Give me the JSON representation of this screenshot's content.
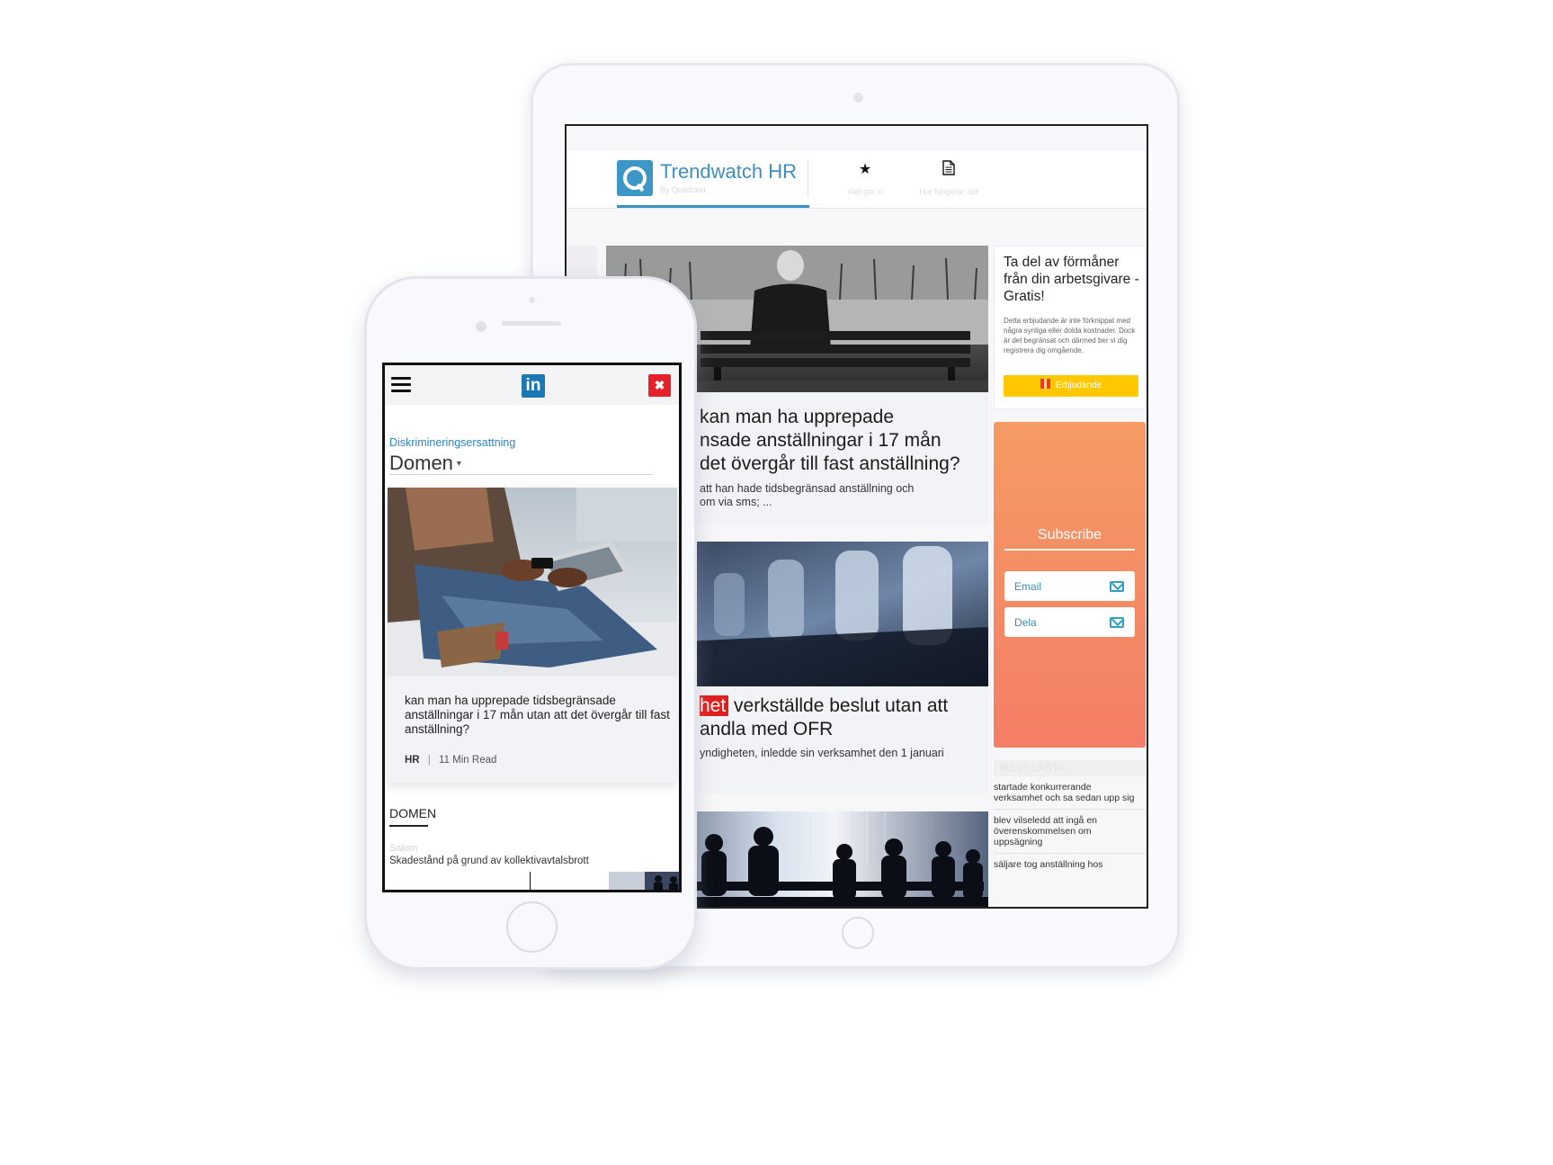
{
  "tablet": {
    "brand": "Trendwatch HR",
    "brand_sub": "By Quaticket",
    "nav": [
      {
        "icon": "star-icon",
        "label": "Vad gör vi"
      },
      {
        "icon": "document-icon",
        "label": "Hur fungerar det"
      }
    ],
    "articles": [
      {
        "title": "kan man ha upprepade tidsbegränsade anställningar i 17 mån utan att det övergår till fast anställning?",
        "title_lines": [
          "kan man ha upprepade",
          "nsade anställningar i 17 mån",
          "det övergår till fast anställning?"
        ],
        "desc_lines": [
          "att han hade tidsbegränsad anställning och",
          "om via sms; ..."
        ]
      },
      {
        "title_red": "het",
        "title_lines": [
          " verkställde beslut utan att",
          "andla med OFR"
        ],
        "desc_lines": [
          "yndigheten, inledde sin verksamhet den 1 januari"
        ]
      }
    ],
    "promo": {
      "title": "Ta del av förmåner från din arbetsgivare - Gratis!",
      "text": "Detta erbjudande är inte förknippat med några synliga eller dolda kostnader. Dock är det begränsat och därmed ber vi dig registrera dig omgående.",
      "button": "Erbjudande"
    },
    "subscribe": {
      "title": "Subscribe",
      "email_placeholder": "Email",
      "share_placeholder": "Dela"
    },
    "mest_lasta": {
      "heading": "MEST LÄSTA",
      "items": [
        "startade konkurrerande verksamhet och sa sedan upp sig",
        "blev vilseledd att ingå en överenskommelsen om uppsägning",
        "säljare tog anställning hos"
      ]
    }
  },
  "phone": {
    "category": "Diskrimineringsersattning",
    "domain_select": "Domen",
    "card": {
      "title": "kan man ha upprepade tidsbegränsade anställningar i 17 mån utan att det övergår till fast anställning?",
      "tag": "HR",
      "separator": "|",
      "read_time": "11 Min Read"
    },
    "section": "DOMEN",
    "sub_label": "Saken",
    "sub_text": "Skadestånd på grund av kollektivavtalsbrott"
  },
  "colors": {
    "brand_blue": "#3d97c6",
    "subscribe_gradient_top": "#f59b63",
    "subscribe_gradient_bottom": "#f47e66",
    "promo_button": "#ffc800",
    "close_red": "#e4212b",
    "linkedin_blue": "#1a78b5"
  }
}
